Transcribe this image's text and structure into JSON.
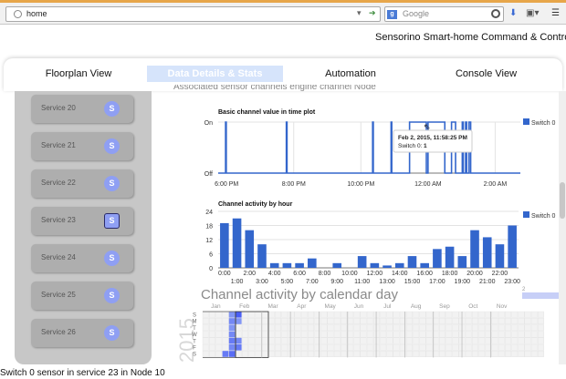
{
  "browser": {
    "url": "home",
    "search_placeholder": "Google"
  },
  "app": {
    "title": "Sensorino Smart-home Command & Control"
  },
  "tabs": [
    {
      "label": "Floorplan View",
      "active": false
    },
    {
      "label": "Data Details & Stats",
      "active": true
    },
    {
      "label": "Automation",
      "active": false
    },
    {
      "label": "Console View",
      "active": false
    }
  ],
  "sidebar": {
    "services": [
      {
        "label": "Service 20",
        "button": "S",
        "selected": false
      },
      {
        "label": "Service 21",
        "button": "S",
        "selected": false
      },
      {
        "label": "Service 22",
        "button": "S",
        "selected": false
      },
      {
        "label": "Service 23",
        "button": "S",
        "selected": true
      },
      {
        "label": "Service 24",
        "button": "S",
        "selected": false
      },
      {
        "label": "Service 25",
        "button": "S",
        "selected": false
      },
      {
        "label": "Service 26",
        "button": "S",
        "selected": false
      }
    ]
  },
  "main": {
    "cut_header": "Associated sensor channels engine channel Node"
  },
  "chart_data": [
    {
      "type": "line",
      "title": "Basic channel value in time plot",
      "yticks": [
        "On",
        "Off"
      ],
      "xticks": [
        "6:00 PM",
        "8:00 PM",
        "10:00 PM",
        "12:00 AM",
        "2:00 AM"
      ],
      "legend": "Switch 0",
      "legend_position": "top-right",
      "pulses": [
        {
          "from": 17.97,
          "to": 17.99
        },
        {
          "from": 19.78,
          "to": 19.8
        },
        {
          "from": 22.35,
          "to": 22.37
        },
        {
          "from": 22.9,
          "to": 22.92
        },
        {
          "from": 23.45,
          "to": 23.95
        },
        {
          "from": 24.0,
          "to": 24.5
        },
        {
          "from": 24.7,
          "to": 24.82
        },
        {
          "from": 25.02,
          "to": 25.05
        },
        {
          "from": 25.12,
          "to": 25.15
        },
        {
          "from": 25.22,
          "to": 25.27
        }
      ],
      "tooltip": {
        "title": "Feb 2, 2015, 11:58:25 PM",
        "series": "Switch 0",
        "value": "1"
      }
    },
    {
      "type": "bar",
      "title": "Channel activity by hour",
      "legend": "Switch 0",
      "legend_position": "top-right",
      "yticks": [
        0,
        6,
        12,
        18,
        24
      ],
      "ylim": [
        0,
        24
      ],
      "categories": [
        "0:00",
        "1:00",
        "2:00",
        "3:00",
        "4:00",
        "5:00",
        "6:00",
        "7:00",
        "8:00",
        "9:00",
        "10:00",
        "11:00",
        "12:00",
        "13:00",
        "14:00",
        "15:00",
        "16:00",
        "17:00",
        "18:00",
        "19:00",
        "20:00",
        "21:00",
        "22:00",
        "23:00"
      ],
      "xticks_top": [
        "0:00",
        "2:00",
        "4:00",
        "6:00",
        "8:00",
        "10:00",
        "12:00",
        "14:00",
        "16:00",
        "18:00",
        "20:00",
        "22:00"
      ],
      "xticks_bottom": [
        "1:00",
        "3:00",
        "5:00",
        "7:00",
        "9:00",
        "11:00",
        "13:00",
        "15:00",
        "17:00",
        "19:00",
        "21:00",
        "23:00"
      ],
      "values": [
        19,
        21,
        16,
        10,
        2,
        2,
        2,
        4,
        0,
        2,
        0,
        5,
        2,
        1,
        2,
        5,
        2,
        8,
        9,
        5,
        16,
        13,
        10,
        18
      ]
    },
    {
      "type": "heatmap",
      "title": "Channel activity by calendar day",
      "year": "2015",
      "days": [
        "S",
        "M",
        "T",
        "W",
        "T",
        "F",
        "S"
      ],
      "months": [
        "Jan",
        "Feb",
        "Mar",
        "Apr",
        "May",
        "Jun",
        "Jul",
        "Aug",
        "Sep",
        "Oct",
        "Nov"
      ],
      "legend_value": "2",
      "active_cells": [
        {
          "week": 4,
          "day": 0,
          "level": 0.5
        },
        {
          "week": 4,
          "day": 1,
          "level": 0.6
        },
        {
          "week": 4,
          "day": 2,
          "level": 0.5
        },
        {
          "week": 4,
          "day": 3,
          "level": 0.6
        },
        {
          "week": 4,
          "day": 4,
          "level": 0.7
        },
        {
          "week": 4,
          "day": 5,
          "level": 0.6
        },
        {
          "week": 4,
          "day": 6,
          "level": 0.8
        },
        {
          "week": 5,
          "day": 0,
          "level": 0.9
        },
        {
          "week": 5,
          "day": 1,
          "level": 0.5
        },
        {
          "week": 5,
          "day": 4,
          "level": 0.6
        },
        {
          "week": 5,
          "day": 5,
          "level": 0.7
        },
        {
          "week": 3,
          "day": 6,
          "level": 0.7
        }
      ]
    }
  ],
  "status": {
    "text": "Switch 0 sensor in service 23 in Node 10"
  },
  "colors": {
    "series": "#3366cc",
    "active_tab_bg": "#d6e4fb",
    "service_button": "#8f9ff3",
    "sidebar_bg": "#c7c7c7"
  }
}
